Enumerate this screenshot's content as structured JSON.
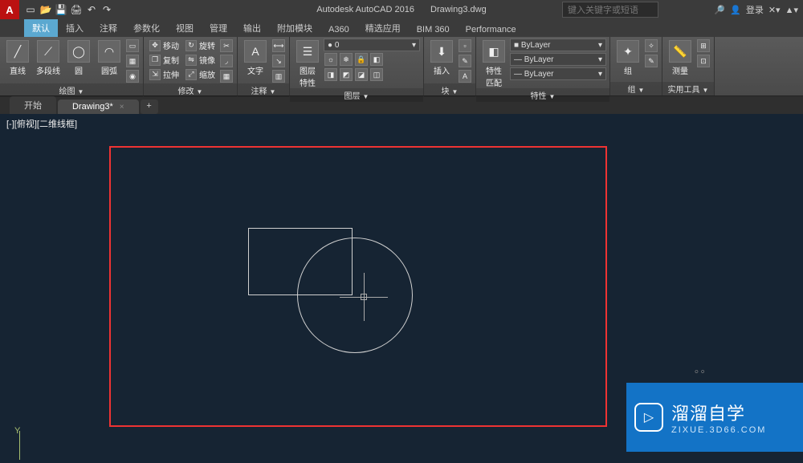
{
  "title": {
    "app": "Autodesk AutoCAD 2016",
    "file": "Drawing3.dwg",
    "search_placeholder": "键入关键字或短语",
    "login": "登录"
  },
  "qat": [
    "□",
    "⌂",
    "🖨",
    "←",
    "→"
  ],
  "ribbon_tabs": [
    "默认",
    "插入",
    "注释",
    "参数化",
    "视图",
    "管理",
    "输出",
    "附加模块",
    "A360",
    "精选应用",
    "BIM 360",
    "Performance"
  ],
  "panels": {
    "draw": {
      "title": "绘图",
      "line": "直线",
      "polyline": "多段线",
      "circle": "圆",
      "arc": "圆弧"
    },
    "modify": {
      "title": "修改",
      "move": "移动",
      "rotate": "旋转",
      "copy": "复制",
      "mirror": "镜像",
      "stretch": "拉伸",
      "scale": "缩放"
    },
    "annot": {
      "title": "注释",
      "text": "文字"
    },
    "layer": {
      "title": "图层",
      "props": "图层\n特性",
      "combo": "0"
    },
    "block": {
      "title": "块",
      "insert": "插入"
    },
    "props": {
      "title": "特性",
      "match": "特性\n匹配",
      "c1": "ByLayer",
      "c2": "ByLayer",
      "c3": "ByLayer"
    },
    "group": {
      "title": "组",
      "g": "组"
    },
    "util": {
      "title": "实用工具",
      "m": "测量"
    }
  },
  "file_tabs": {
    "t1": "开始",
    "t2": "Drawing3*"
  },
  "viewport": {
    "label": "[-][俯视][二维线框]"
  },
  "watermark": {
    "title": "溜溜自学",
    "url": "ZIXUE.3D66.COM"
  }
}
